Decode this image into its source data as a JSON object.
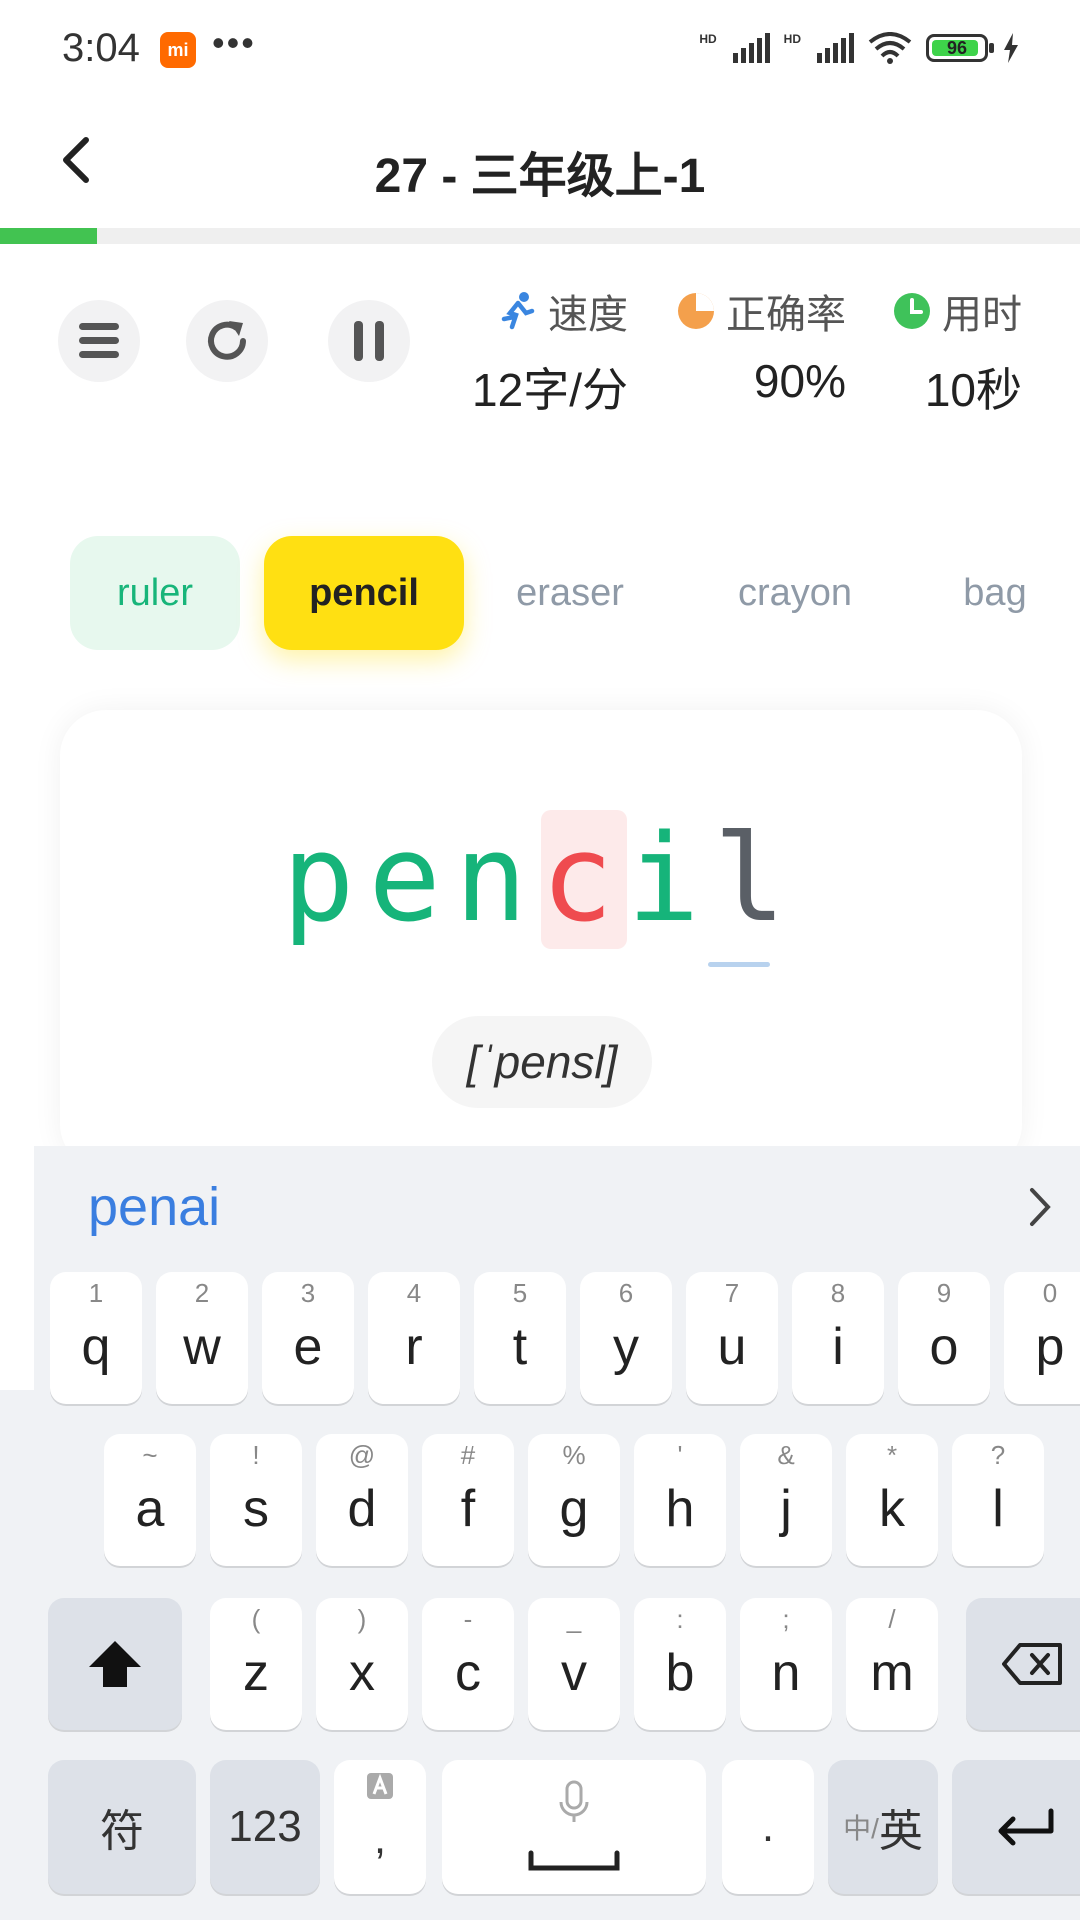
{
  "status": {
    "time": "3:04",
    "mi_badge": "mi",
    "dots": "•••",
    "hd1": "HD",
    "hd2": "HD",
    "battery": "96"
  },
  "header": {
    "title": "27 - 三年级上-1"
  },
  "progress": {
    "fraction": 0.09
  },
  "stats": [
    {
      "label": "速度",
      "value": "12字/分",
      "icon": "runner-icon",
      "color": "#3a86e0"
    },
    {
      "label": "正确率",
      "value": "90%",
      "icon": "pie-icon",
      "color": "#f4a04c"
    },
    {
      "label": "用时",
      "value": "10秒",
      "icon": "clock-icon",
      "color": "#3fc25a"
    }
  ],
  "words": [
    {
      "label": "ruler",
      "state": "done"
    },
    {
      "label": "pencil",
      "state": "active"
    },
    {
      "label": "eraser",
      "state": "todo"
    },
    {
      "label": "crayon",
      "state": "todo"
    },
    {
      "label": "bag",
      "state": "todo"
    }
  ],
  "current_word": {
    "letters": [
      {
        "ch": "p",
        "state": "ok"
      },
      {
        "ch": "e",
        "state": "ok"
      },
      {
        "ch": "n",
        "state": "ok"
      },
      {
        "ch": "c",
        "state": "err"
      },
      {
        "ch": "i",
        "state": "ok"
      },
      {
        "ch": "l",
        "state": "pending"
      }
    ],
    "phonetic": "[ˈpensl]"
  },
  "keyboard": {
    "candidate": "penai",
    "row1": [
      {
        "main": "q",
        "alt": "1"
      },
      {
        "main": "w",
        "alt": "2"
      },
      {
        "main": "e",
        "alt": "3"
      },
      {
        "main": "r",
        "alt": "4"
      },
      {
        "main": "t",
        "alt": "5"
      },
      {
        "main": "y",
        "alt": "6"
      },
      {
        "main": "u",
        "alt": "7"
      },
      {
        "main": "i",
        "alt": "8"
      },
      {
        "main": "o",
        "alt": "9"
      },
      {
        "main": "p",
        "alt": "0"
      }
    ],
    "row2": [
      {
        "main": "a",
        "alt": "~"
      },
      {
        "main": "s",
        "alt": "!"
      },
      {
        "main": "d",
        "alt": "@"
      },
      {
        "main": "f",
        "alt": "#"
      },
      {
        "main": "g",
        "alt": "%"
      },
      {
        "main": "h",
        "alt": "'"
      },
      {
        "main": "j",
        "alt": "&"
      },
      {
        "main": "k",
        "alt": "*"
      },
      {
        "main": "l",
        "alt": "?"
      }
    ],
    "row3": [
      {
        "main": "z",
        "alt": "("
      },
      {
        "main": "x",
        "alt": ")"
      },
      {
        "main": "c",
        "alt": "-"
      },
      {
        "main": "v",
        "alt": "_"
      },
      {
        "main": "b",
        "alt": ":"
      },
      {
        "main": "n",
        "alt": ";"
      },
      {
        "main": "m",
        "alt": "/"
      }
    ],
    "symbol_key": "符",
    "num_key": "123",
    "comma_key": ",",
    "period_key": ".",
    "lang_key_small": "中/",
    "lang_key_big": "英"
  }
}
